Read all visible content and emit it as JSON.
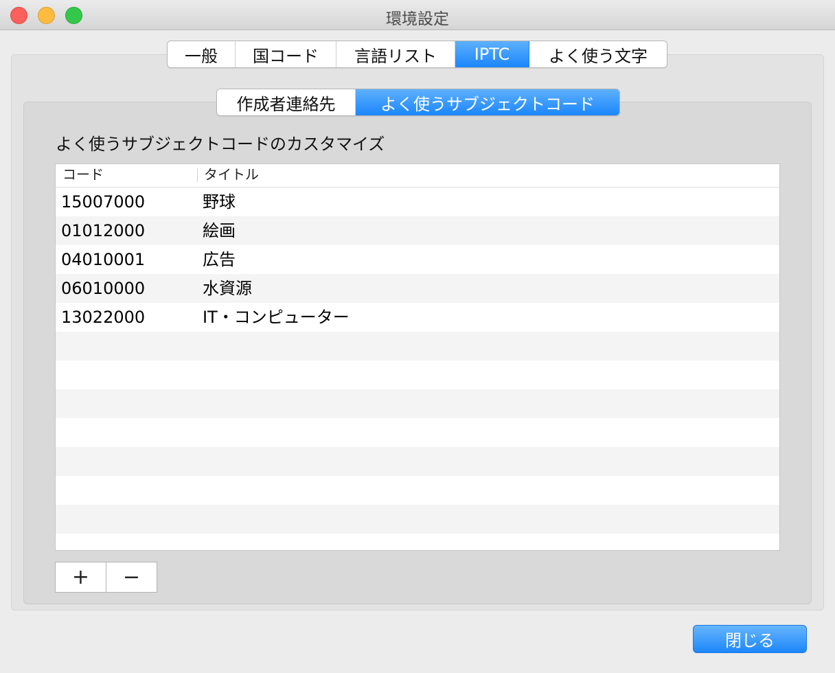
{
  "window": {
    "title": "環境設定"
  },
  "main_tabs": [
    {
      "label": "一般",
      "active": false
    },
    {
      "label": "国コード",
      "active": false
    },
    {
      "label": "言語リスト",
      "active": false
    },
    {
      "label": "IPTC",
      "active": true
    },
    {
      "label": "よく使う文字",
      "active": false
    }
  ],
  "sub_tabs": [
    {
      "label": "作成者連絡先",
      "active": false
    },
    {
      "label": "よく使うサブジェクトコード",
      "active": true
    }
  ],
  "section_label": "よく使うサブジェクトコードのカスタマイズ",
  "table": {
    "columns": {
      "code": "コード",
      "title": "タイトル"
    },
    "rows": [
      {
        "code": "15007000",
        "title": "野球"
      },
      {
        "code": "01012000",
        "title": "絵画"
      },
      {
        "code": "04010001",
        "title": "広告"
      },
      {
        "code": "06010000",
        "title": "水資源"
      },
      {
        "code": "13022000",
        "title": "IT・コンピューター"
      }
    ]
  },
  "buttons": {
    "add": "+",
    "remove": "−",
    "close": "閉じる"
  },
  "colors": {
    "accent": "#1b86fb",
    "close_red": "#fc605c",
    "minimize_yellow": "#fdbc40",
    "maximize_green": "#34c84a"
  }
}
